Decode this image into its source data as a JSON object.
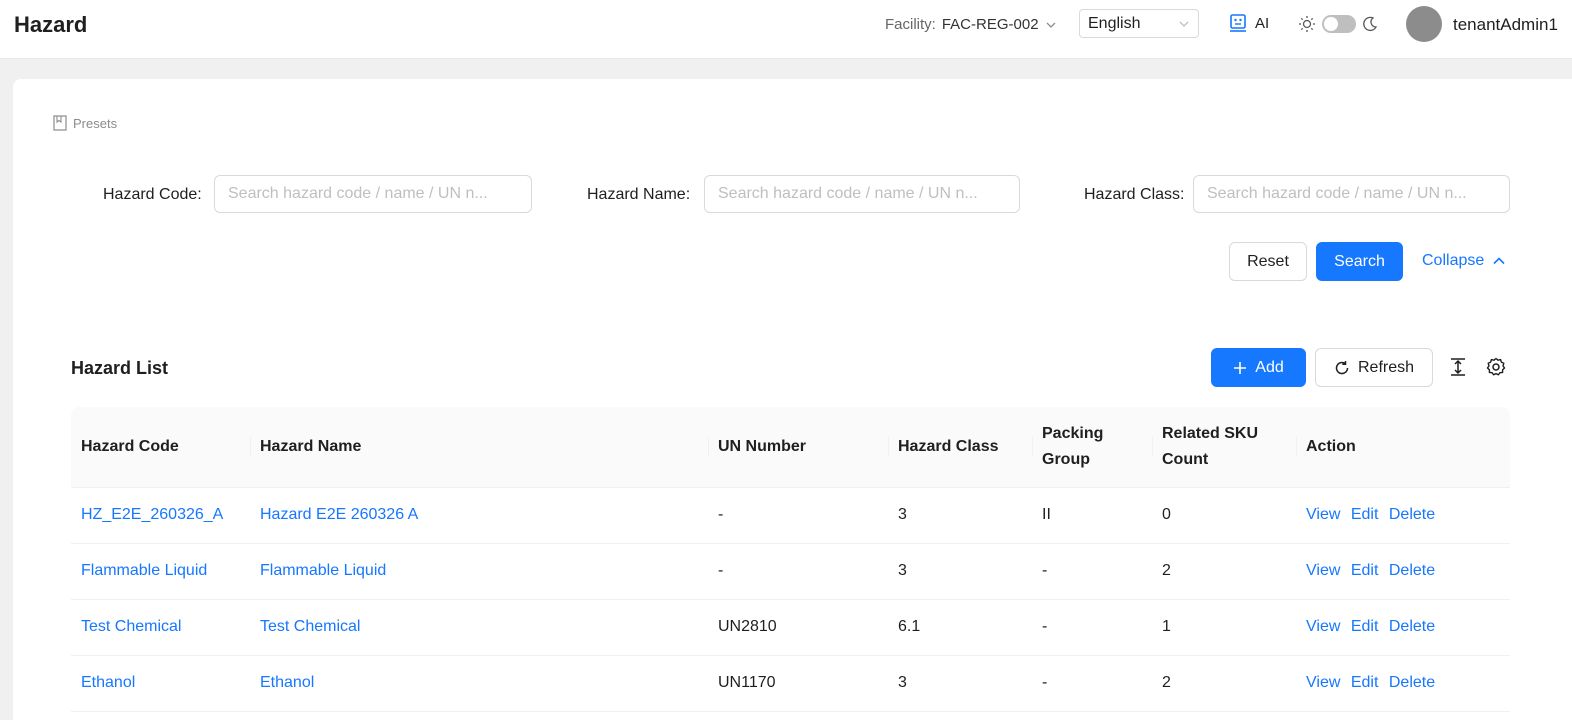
{
  "header": {
    "title": "Hazard",
    "facility_label": "Facility:",
    "facility_value": "FAC-REG-002",
    "language": "English",
    "ai_label": "AI",
    "username": "tenantAdmin1"
  },
  "presets_label": "Presets",
  "filters": [
    {
      "label": "Hazard Code",
      "placeholder": "Search hazard code / name / UN n..."
    },
    {
      "label": "Hazard Name",
      "placeholder": "Search hazard code / name / UN n..."
    },
    {
      "label": "Hazard Class",
      "placeholder": "Search hazard code / name / UN n..."
    }
  ],
  "buttons": {
    "reset": "Reset",
    "search": "Search",
    "collapse": "Collapse",
    "add": "Add",
    "refresh": "Refresh"
  },
  "list": {
    "title": "Hazard List",
    "columns": [
      "Hazard Code",
      "Hazard Name",
      "UN Number",
      "Hazard Class",
      "Packing Group",
      "Related SKU Count",
      "Action"
    ],
    "actions": [
      "View",
      "Edit",
      "Delete"
    ],
    "rows": [
      {
        "code": "HZ_E2E_260326_A",
        "name": "Hazard E2E 260326 A",
        "un": "-",
        "class": "3",
        "packing": "II",
        "sku_count": "0"
      },
      {
        "code": "Flammable Liquid",
        "name": "Flammable Liquid",
        "un": "-",
        "class": "3",
        "packing": "-",
        "sku_count": "2"
      },
      {
        "code": "Test Chemical",
        "name": "Test Chemical",
        "un": "UN2810",
        "class": "6.1",
        "packing": "-",
        "sku_count": "1"
      },
      {
        "code": "Ethanol",
        "name": "Ethanol",
        "un": "UN1170",
        "class": "3",
        "packing": "-",
        "sku_count": "2"
      }
    ]
  },
  "colors": {
    "primary": "#1677ff",
    "background": "#f0f0f0",
    "card": "#ffffff"
  }
}
